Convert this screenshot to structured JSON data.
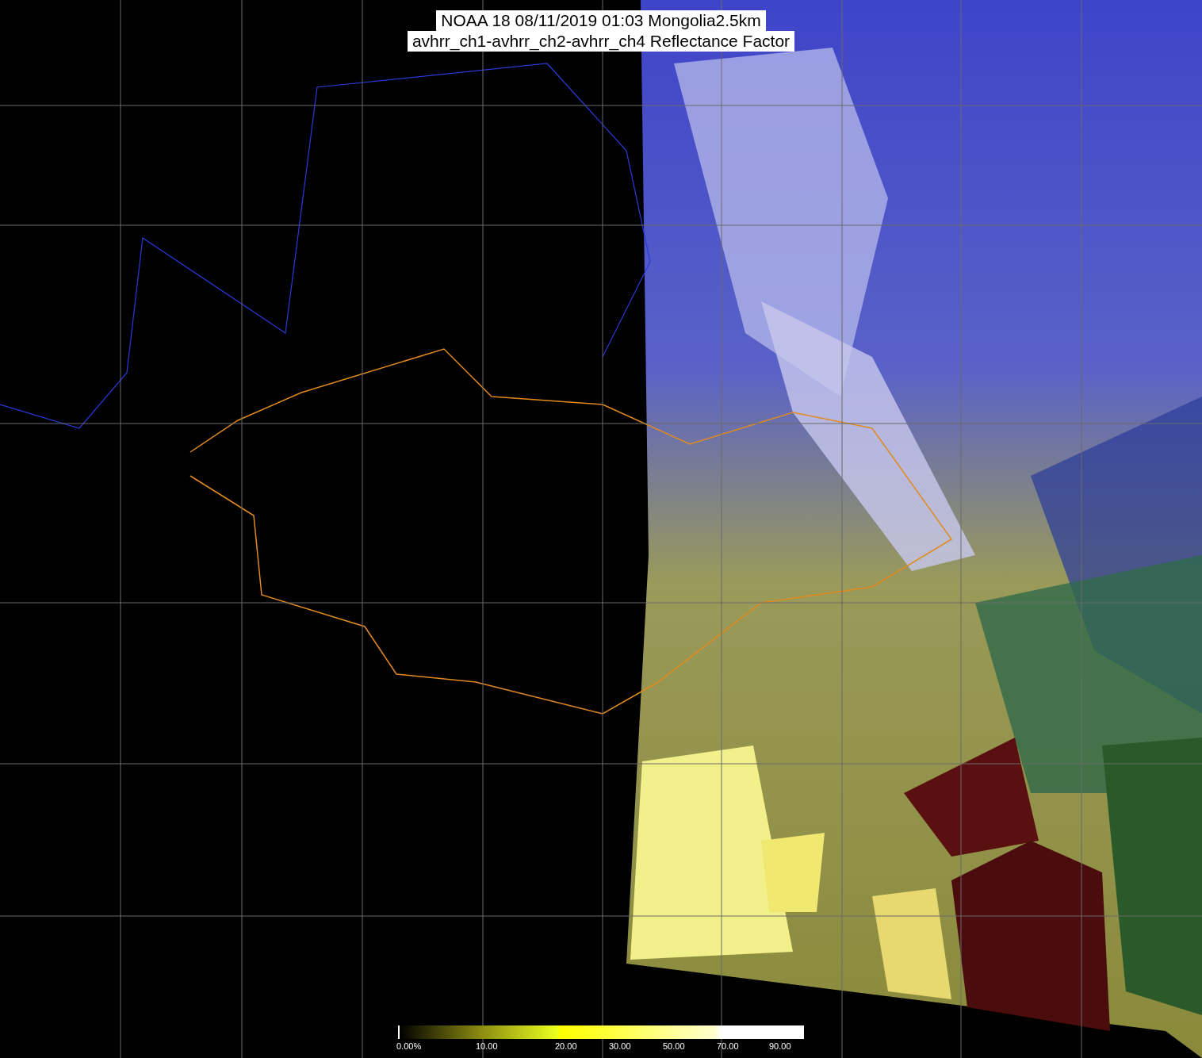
{
  "title": {
    "lines": [
      "NOAA 18 08/11/2019 01:03 Mongolia2.5km",
      "avhrr_ch1-avhrr_ch2-avhrr_ch4 Reflectance Factor"
    ]
  },
  "colorbar": {
    "labels": [
      "0.00%",
      "10.00",
      "20.00",
      "30.00",
      "50.00",
      "70.00",
      "90.00"
    ]
  }
}
